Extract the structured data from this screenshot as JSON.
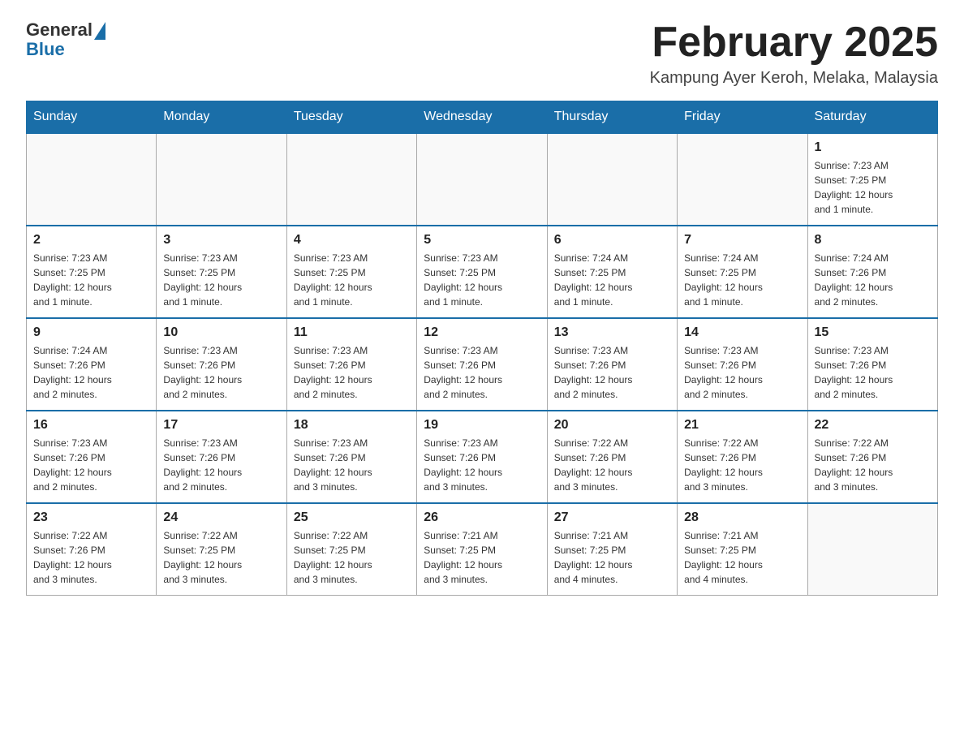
{
  "header": {
    "logo_general": "General",
    "logo_blue": "Blue",
    "month_title": "February 2025",
    "location": "Kampung Ayer Keroh, Melaka, Malaysia"
  },
  "weekdays": [
    "Sunday",
    "Monday",
    "Tuesday",
    "Wednesday",
    "Thursday",
    "Friday",
    "Saturday"
  ],
  "weeks": [
    [
      {
        "day": "",
        "info": ""
      },
      {
        "day": "",
        "info": ""
      },
      {
        "day": "",
        "info": ""
      },
      {
        "day": "",
        "info": ""
      },
      {
        "day": "",
        "info": ""
      },
      {
        "day": "",
        "info": ""
      },
      {
        "day": "1",
        "info": "Sunrise: 7:23 AM\nSunset: 7:25 PM\nDaylight: 12 hours\nand 1 minute."
      }
    ],
    [
      {
        "day": "2",
        "info": "Sunrise: 7:23 AM\nSunset: 7:25 PM\nDaylight: 12 hours\nand 1 minute."
      },
      {
        "day": "3",
        "info": "Sunrise: 7:23 AM\nSunset: 7:25 PM\nDaylight: 12 hours\nand 1 minute."
      },
      {
        "day": "4",
        "info": "Sunrise: 7:23 AM\nSunset: 7:25 PM\nDaylight: 12 hours\nand 1 minute."
      },
      {
        "day": "5",
        "info": "Sunrise: 7:23 AM\nSunset: 7:25 PM\nDaylight: 12 hours\nand 1 minute."
      },
      {
        "day": "6",
        "info": "Sunrise: 7:24 AM\nSunset: 7:25 PM\nDaylight: 12 hours\nand 1 minute."
      },
      {
        "day": "7",
        "info": "Sunrise: 7:24 AM\nSunset: 7:25 PM\nDaylight: 12 hours\nand 1 minute."
      },
      {
        "day": "8",
        "info": "Sunrise: 7:24 AM\nSunset: 7:26 PM\nDaylight: 12 hours\nand 2 minutes."
      }
    ],
    [
      {
        "day": "9",
        "info": "Sunrise: 7:24 AM\nSunset: 7:26 PM\nDaylight: 12 hours\nand 2 minutes."
      },
      {
        "day": "10",
        "info": "Sunrise: 7:23 AM\nSunset: 7:26 PM\nDaylight: 12 hours\nand 2 minutes."
      },
      {
        "day": "11",
        "info": "Sunrise: 7:23 AM\nSunset: 7:26 PM\nDaylight: 12 hours\nand 2 minutes."
      },
      {
        "day": "12",
        "info": "Sunrise: 7:23 AM\nSunset: 7:26 PM\nDaylight: 12 hours\nand 2 minutes."
      },
      {
        "day": "13",
        "info": "Sunrise: 7:23 AM\nSunset: 7:26 PM\nDaylight: 12 hours\nand 2 minutes."
      },
      {
        "day": "14",
        "info": "Sunrise: 7:23 AM\nSunset: 7:26 PM\nDaylight: 12 hours\nand 2 minutes."
      },
      {
        "day": "15",
        "info": "Sunrise: 7:23 AM\nSunset: 7:26 PM\nDaylight: 12 hours\nand 2 minutes."
      }
    ],
    [
      {
        "day": "16",
        "info": "Sunrise: 7:23 AM\nSunset: 7:26 PM\nDaylight: 12 hours\nand 2 minutes."
      },
      {
        "day": "17",
        "info": "Sunrise: 7:23 AM\nSunset: 7:26 PM\nDaylight: 12 hours\nand 2 minutes."
      },
      {
        "day": "18",
        "info": "Sunrise: 7:23 AM\nSunset: 7:26 PM\nDaylight: 12 hours\nand 3 minutes."
      },
      {
        "day": "19",
        "info": "Sunrise: 7:23 AM\nSunset: 7:26 PM\nDaylight: 12 hours\nand 3 minutes."
      },
      {
        "day": "20",
        "info": "Sunrise: 7:22 AM\nSunset: 7:26 PM\nDaylight: 12 hours\nand 3 minutes."
      },
      {
        "day": "21",
        "info": "Sunrise: 7:22 AM\nSunset: 7:26 PM\nDaylight: 12 hours\nand 3 minutes."
      },
      {
        "day": "22",
        "info": "Sunrise: 7:22 AM\nSunset: 7:26 PM\nDaylight: 12 hours\nand 3 minutes."
      }
    ],
    [
      {
        "day": "23",
        "info": "Sunrise: 7:22 AM\nSunset: 7:26 PM\nDaylight: 12 hours\nand 3 minutes."
      },
      {
        "day": "24",
        "info": "Sunrise: 7:22 AM\nSunset: 7:25 PM\nDaylight: 12 hours\nand 3 minutes."
      },
      {
        "day": "25",
        "info": "Sunrise: 7:22 AM\nSunset: 7:25 PM\nDaylight: 12 hours\nand 3 minutes."
      },
      {
        "day": "26",
        "info": "Sunrise: 7:21 AM\nSunset: 7:25 PM\nDaylight: 12 hours\nand 3 minutes."
      },
      {
        "day": "27",
        "info": "Sunrise: 7:21 AM\nSunset: 7:25 PM\nDaylight: 12 hours\nand 4 minutes."
      },
      {
        "day": "28",
        "info": "Sunrise: 7:21 AM\nSunset: 7:25 PM\nDaylight: 12 hours\nand 4 minutes."
      },
      {
        "day": "",
        "info": ""
      }
    ]
  ]
}
